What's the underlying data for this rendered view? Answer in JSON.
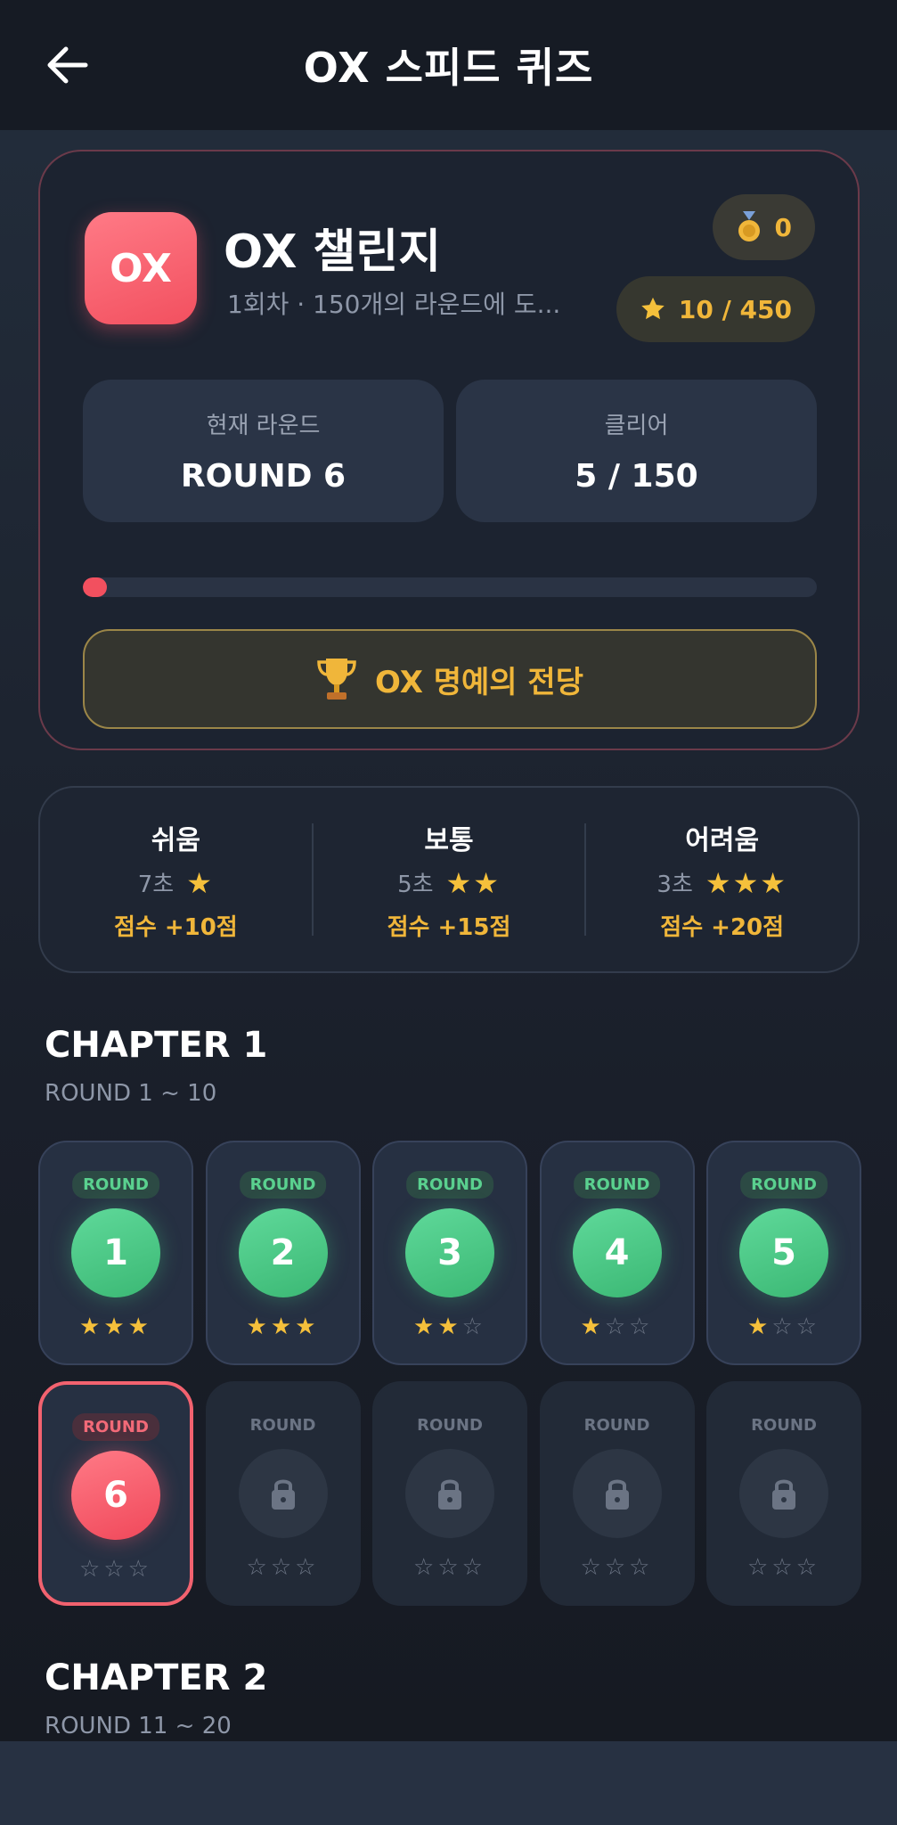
{
  "header": {
    "title": "OX 스피드 퀴즈",
    "back_icon": "arrow-left-icon"
  },
  "hero": {
    "logo_text": "OX",
    "title": "OX 챌린지",
    "subtitle": "1회차  ·  150개의 라운드에 도...",
    "medal_count": "0",
    "stars_text": "10 / 450",
    "current_round_label": "현재 라운드",
    "current_round_value": "ROUND 6",
    "clear_label": "클리어",
    "clear_value": "5 / 150",
    "progress": 0.033,
    "hall_of_fame_label": "OX 명예의 전당"
  },
  "difficulties": [
    {
      "name": "쉬움",
      "time": "7초",
      "stars": 1,
      "score": "점수 +10점"
    },
    {
      "name": "보통",
      "time": "5초",
      "stars": 2,
      "score": "점수 +15점"
    },
    {
      "name": "어려움",
      "time": "3초",
      "stars": 3,
      "score": "점수 +20점"
    }
  ],
  "chapters": [
    {
      "title": "CHAPTER 1",
      "range": "ROUND 1 ~ 10",
      "rounds": [
        {
          "badge": "ROUND",
          "number": "1",
          "stars": 3,
          "state": "cleared"
        },
        {
          "badge": "ROUND",
          "number": "2",
          "stars": 3,
          "state": "cleared"
        },
        {
          "badge": "ROUND",
          "number": "3",
          "stars": 2,
          "state": "cleared"
        },
        {
          "badge": "ROUND",
          "number": "4",
          "stars": 1,
          "state": "cleared"
        },
        {
          "badge": "ROUND",
          "number": "5",
          "stars": 1,
          "state": "cleared"
        },
        {
          "badge": "ROUND",
          "number": "6",
          "stars": 0,
          "state": "current"
        },
        {
          "badge": "ROUND",
          "number": "",
          "stars": 0,
          "state": "locked"
        },
        {
          "badge": "ROUND",
          "number": "",
          "stars": 0,
          "state": "locked"
        },
        {
          "badge": "ROUND",
          "number": "",
          "stars": 0,
          "state": "locked"
        },
        {
          "badge": "ROUND",
          "number": "",
          "stars": 0,
          "state": "locked"
        }
      ]
    },
    {
      "title": "CHAPTER 2",
      "range": "ROUND 11 ~ 20"
    }
  ],
  "colors": {
    "accent_red": "#f2505f",
    "accent_gold": "#f0b63a",
    "accent_green": "#3bb874"
  }
}
